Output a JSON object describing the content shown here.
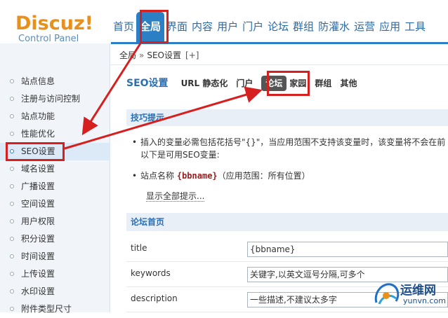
{
  "logo": {
    "brand": "Discuz!",
    "subtitle": "Control Panel"
  },
  "topnav": {
    "tabs": [
      "首页",
      "全局",
      "界面",
      "内容",
      "用户",
      "门户",
      "论坛",
      "群组",
      "防灌水",
      "运营",
      "应用",
      "工具"
    ],
    "active_index": 1
  },
  "breadcrumb": {
    "root": "全局",
    "sep": "»",
    "current": "SEO设置",
    "plus": "[+]"
  },
  "sidebar": {
    "items": [
      "站点信息",
      "注册与访问控制",
      "站点功能",
      "性能优化",
      "SEO设置",
      "域名设置",
      "广播设置",
      "空间设置",
      "用户权限",
      "积分设置",
      "时间设置",
      "上传设置",
      "水印设置",
      "附件类型尺寸"
    ],
    "active_index": 4
  },
  "subnav": {
    "title": "SEO设置",
    "tabs": [
      "URL 静态化",
      "门户",
      "论坛",
      "家园",
      "群组",
      "其他"
    ],
    "active_index": 2
  },
  "tips": {
    "heading": "技巧提示",
    "line1": "插入的变量必需包括花括号\"{}\"，当应用范围不支持该变量时，该变量将不会在前",
    "line2": "以下是可用SEO变量:",
    "var_prefix": "站点名称",
    "var_code": "{bbname}",
    "var_suffix": "（应用范围：所有位置）",
    "show_all": "显示全部提示..."
  },
  "section": {
    "heading": "论坛首页"
  },
  "fields": [
    {
      "label": "title",
      "value": "{bbname}"
    },
    {
      "label": "keywords",
      "value": "关键字,以英文逗号分隔,可多个"
    },
    {
      "label": "description",
      "value": "一些描述,不建议太多字"
    }
  ],
  "watermark": {
    "cn": "运维网",
    "en": "yunvn.com"
  },
  "colors": {
    "accent": "#2b7fc4",
    "highlight": "#d61f1f",
    "logo": "#e8901c"
  }
}
